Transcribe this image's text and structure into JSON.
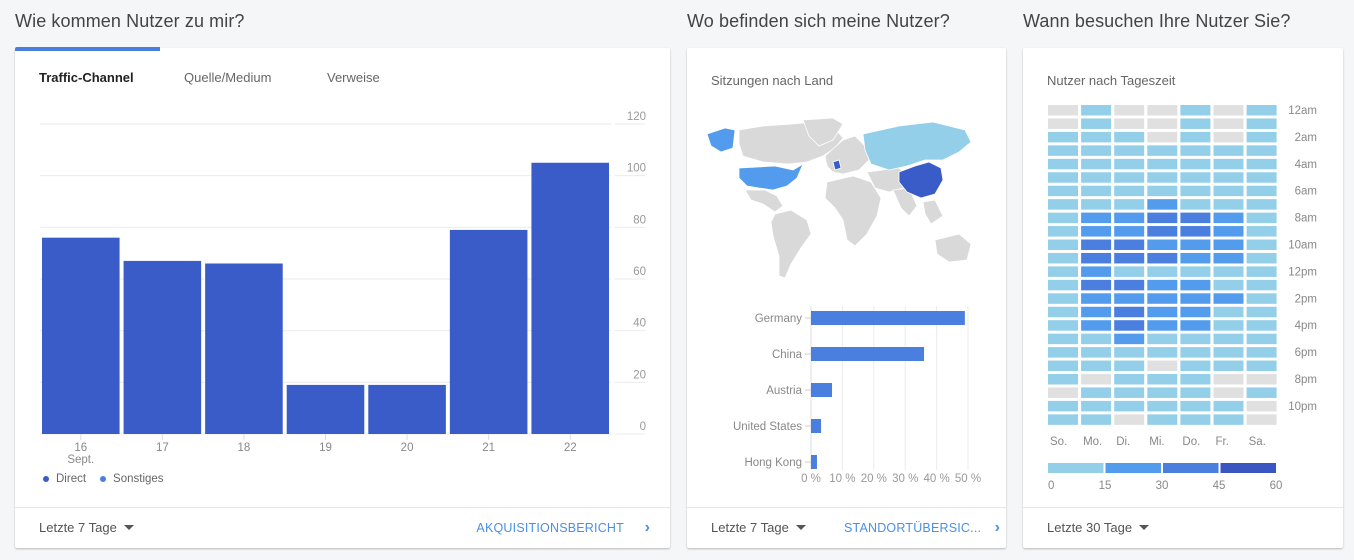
{
  "sections": {
    "acquisition_title": "Wie kommen Nutzer zu mir?",
    "location_title": "Wo befinden sich meine Nutzer?",
    "time_title": "Wann besuchen Ihre Nutzer Sie?"
  },
  "acquisition": {
    "tabs": [
      "Traffic-Channel",
      "Quelle/Medium",
      "Verweise"
    ],
    "active_tab": 0,
    "range": "Letzte 7 Tage",
    "report_link": "AKQUISITIONSBERICHT",
    "legend": [
      {
        "label": "Direct",
        "color": "#3a5cc9"
      },
      {
        "label": "Sonstiges",
        "color": "#4a7fe0"
      }
    ]
  },
  "location": {
    "subtitle": "Sitzungen nach Land",
    "range": "Letzte 7 Tage",
    "report_link": "STANDORTÜBERSIC...",
    "map_colors": {
      "Germany": "#3a5cc9",
      "China": "#3a5cc9",
      "Austria": "#4a7fe0",
      "United States": "#539ced",
      "Russia": "#93cfe8",
      "other": "#d9d9d9"
    }
  },
  "time": {
    "subtitle": "Nutzer nach Tageszeit",
    "range": "Letzte 30 Tage"
  },
  "chart_data": [
    {
      "type": "bar",
      "title": "Traffic-Channel",
      "categories": [
        "16",
        "17",
        "18",
        "19",
        "20",
        "21",
        "22"
      ],
      "category_sublabels": [
        "Sept.",
        "",
        "",
        "",
        "",
        "",
        ""
      ],
      "series": [
        {
          "name": "Direct",
          "values": [
            76,
            67,
            66,
            19,
            19,
            79,
            105
          ]
        }
      ],
      "yticks": [
        0,
        20,
        40,
        60,
        80,
        100,
        120
      ],
      "ylim": [
        0,
        120
      ],
      "grid": true,
      "legend": "bottom-left",
      "color": "#3a5cc9"
    },
    {
      "type": "bar",
      "orientation": "horizontal",
      "title": "Sitzungen nach Land",
      "categories": [
        "Germany",
        "China",
        "Austria",
        "United States",
        "Hong Kong"
      ],
      "values": [
        49,
        36,
        6.7,
        3.2,
        1.9
      ],
      "unit": "%",
      "xticks": [
        "0 %",
        "10 %",
        "20 %",
        "30 %",
        "40 %",
        "50 %"
      ],
      "xlim": [
        0,
        50
      ],
      "color": "#4a7fe0"
    },
    {
      "type": "heatmap",
      "title": "Nutzer nach Tageszeit",
      "columns": [
        "So.",
        "Mo.",
        "Di.",
        "Mi.",
        "Do.",
        "Fr.",
        "Sa."
      ],
      "row_labels": [
        "12am",
        "",
        "2am",
        "",
        "4am",
        "",
        "6am",
        "",
        "8am",
        "",
        "10am",
        "",
        "12pm",
        "",
        "2pm",
        "",
        "4pm",
        "",
        "6pm",
        "",
        "8pm",
        "",
        "10pm",
        ""
      ],
      "levels": [
        [
          0,
          1,
          0,
          0,
          1,
          0,
          1
        ],
        [
          0,
          1,
          0,
          0,
          1,
          0,
          1
        ],
        [
          1,
          1,
          1,
          0,
          1,
          0,
          1
        ],
        [
          1,
          1,
          1,
          1,
          1,
          1,
          1
        ],
        [
          1,
          1,
          1,
          1,
          1,
          1,
          1
        ],
        [
          1,
          1,
          1,
          1,
          1,
          1,
          1
        ],
        [
          1,
          1,
          1,
          1,
          1,
          1,
          1
        ],
        [
          1,
          1,
          1,
          2,
          1,
          1,
          1
        ],
        [
          1,
          2,
          2,
          3,
          3,
          2,
          1
        ],
        [
          1,
          2,
          2,
          3,
          3,
          2,
          1
        ],
        [
          1,
          3,
          3,
          2,
          2,
          2,
          1
        ],
        [
          1,
          3,
          3,
          3,
          2,
          2,
          1
        ],
        [
          1,
          2,
          1,
          1,
          1,
          1,
          1
        ],
        [
          1,
          3,
          3,
          2,
          2,
          1,
          1
        ],
        [
          1,
          2,
          2,
          2,
          2,
          2,
          1
        ],
        [
          1,
          2,
          3,
          2,
          2,
          1,
          1
        ],
        [
          1,
          2,
          3,
          2,
          2,
          1,
          1
        ],
        [
          1,
          1,
          2,
          1,
          1,
          1,
          1
        ],
        [
          1,
          1,
          1,
          1,
          1,
          1,
          1
        ],
        [
          1,
          1,
          1,
          0,
          1,
          1,
          1
        ],
        [
          1,
          0,
          1,
          1,
          1,
          0,
          0
        ],
        [
          0,
          1,
          1,
          1,
          1,
          0,
          1
        ],
        [
          1,
          1,
          1,
          1,
          1,
          1,
          0
        ],
        [
          1,
          1,
          0,
          1,
          1,
          1,
          0
        ]
      ],
      "level_colors": [
        "#e0e0e0",
        "#93cfe8",
        "#539ced",
        "#4a7fe0",
        "#3a56c0"
      ],
      "scale_ticks": [
        "0",
        "15",
        "30",
        "45",
        "60"
      ],
      "scale_colors": [
        "#93cfe8",
        "#539ced",
        "#4a7fe0",
        "#3a56c0"
      ]
    }
  ]
}
